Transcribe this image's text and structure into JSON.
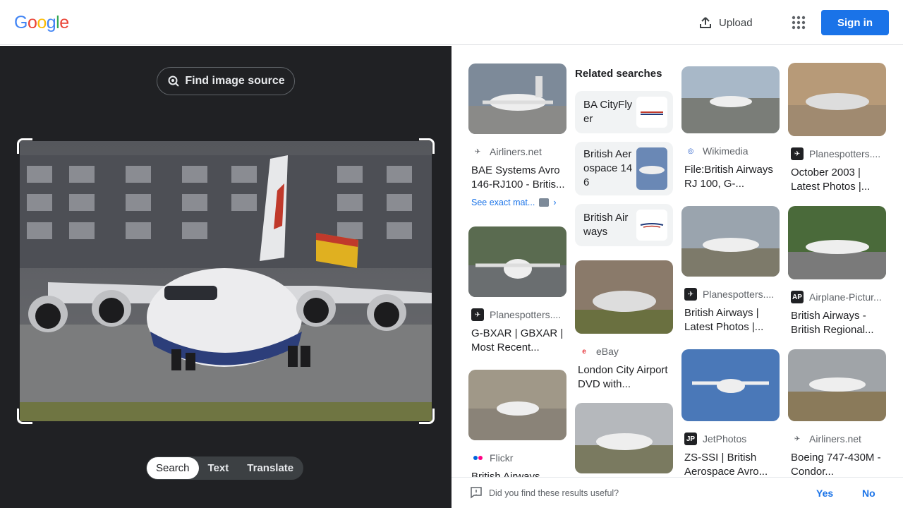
{
  "header": {
    "logo_letters": [
      "G",
      "o",
      "o",
      "g",
      "l",
      "e"
    ],
    "logo_colors": [
      "#4285F4",
      "#EA4335",
      "#FBBC05",
      "#4285F4",
      "#34A853",
      "#EA4335"
    ],
    "upload_label": "Upload",
    "signin_label": "Sign in"
  },
  "left_panel": {
    "find_source_label": "Find image source",
    "modes": [
      "Search",
      "Text",
      "Translate"
    ],
    "active_mode": "Search"
  },
  "results": {
    "related_searches_title": "Related searches",
    "related": [
      {
        "label": "BA CityFlyer"
      },
      {
        "label": "British Aerospace 146"
      },
      {
        "label": "British Airways"
      }
    ],
    "cards": [
      {
        "source": "Airliners.net",
        "title": "BAE Systems Avro 146-RJ100 - Britis...",
        "exact": "See exact mat..."
      },
      {
        "source": "Planespotters....",
        "title": "G-BXAR | GBXAR | Most Recent..."
      },
      {
        "source": "Flickr",
        "title": "British Airways"
      },
      {
        "source": "eBay",
        "title": "London City Airport DVD with..."
      },
      {
        "source": "Wikimedia",
        "title": "File:British Airways RJ 100, G-..."
      },
      {
        "source": "Planespotters....",
        "title": "British Airways | Latest Photos |..."
      },
      {
        "source": "JetPhotos",
        "title": "ZS-SSI | British Aerospace Avro..."
      },
      {
        "source": "Planespotters....",
        "title": "October 2003 | Latest Photos |..."
      },
      {
        "source": "Airplane-Pictur...",
        "title": "British Airways - British Regional..."
      },
      {
        "source": "Airliners.net",
        "title": "Boeing 747-430M - Condor..."
      }
    ]
  },
  "feedback": {
    "question": "Did you find these results useful?",
    "yes": "Yes",
    "no": "No"
  },
  "colors": {
    "accent": "#1a73e8",
    "left_bg": "#202124"
  }
}
